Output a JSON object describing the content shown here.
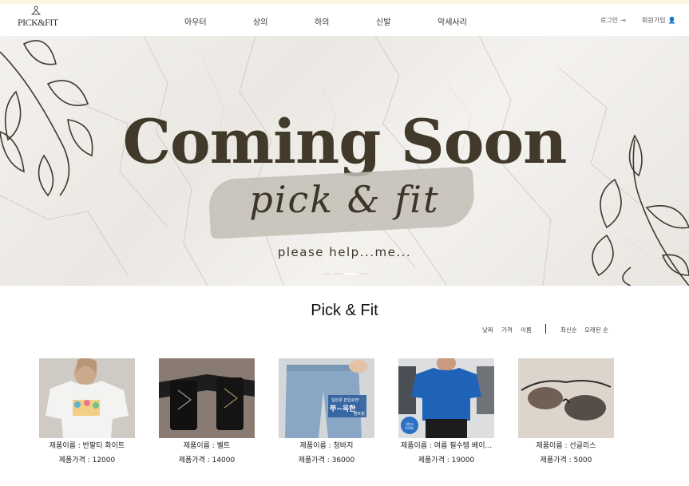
{
  "header": {
    "logo_text": "PICK&FIT",
    "nav": [
      "아우터",
      "상의",
      "하의",
      "신발",
      "악세사리"
    ],
    "login_label": "로그인",
    "signup_label": "회원가입"
  },
  "banner": {
    "title": "Coming Soon",
    "script_text": "pick & fit",
    "subtitle": "please help...me..."
  },
  "section": {
    "title": "Pick & Fit",
    "sort_options": [
      "낮짜",
      "가격",
      "이름",
      "최신순",
      "오래된 순"
    ]
  },
  "products": [
    {
      "name": "제품이름 : 반팔티 화이트",
      "price": "제품가격 : 12000"
    },
    {
      "name": "제품이름 : 벨트",
      "price": "제품가격 : 14000"
    },
    {
      "name": "제품이름 : 청바지",
      "price": "제품가격 : 36000"
    },
    {
      "name": "제품이름 : 여름 필수템 베이...",
      "price": "제품가격 : 19000"
    },
    {
      "name": "제품이름 : 선글리스",
      "price": "제품가격 : 5000"
    }
  ],
  "product_badge": {
    "line1": "일본론 판입로한!",
    "line2": "쭈~욱한",
    "line3": "팬트핏",
    "cool_text": "Ultra COOL"
  },
  "colors": {
    "accent_top": "#fbf5e0",
    "banner_text": "#413a2a"
  }
}
